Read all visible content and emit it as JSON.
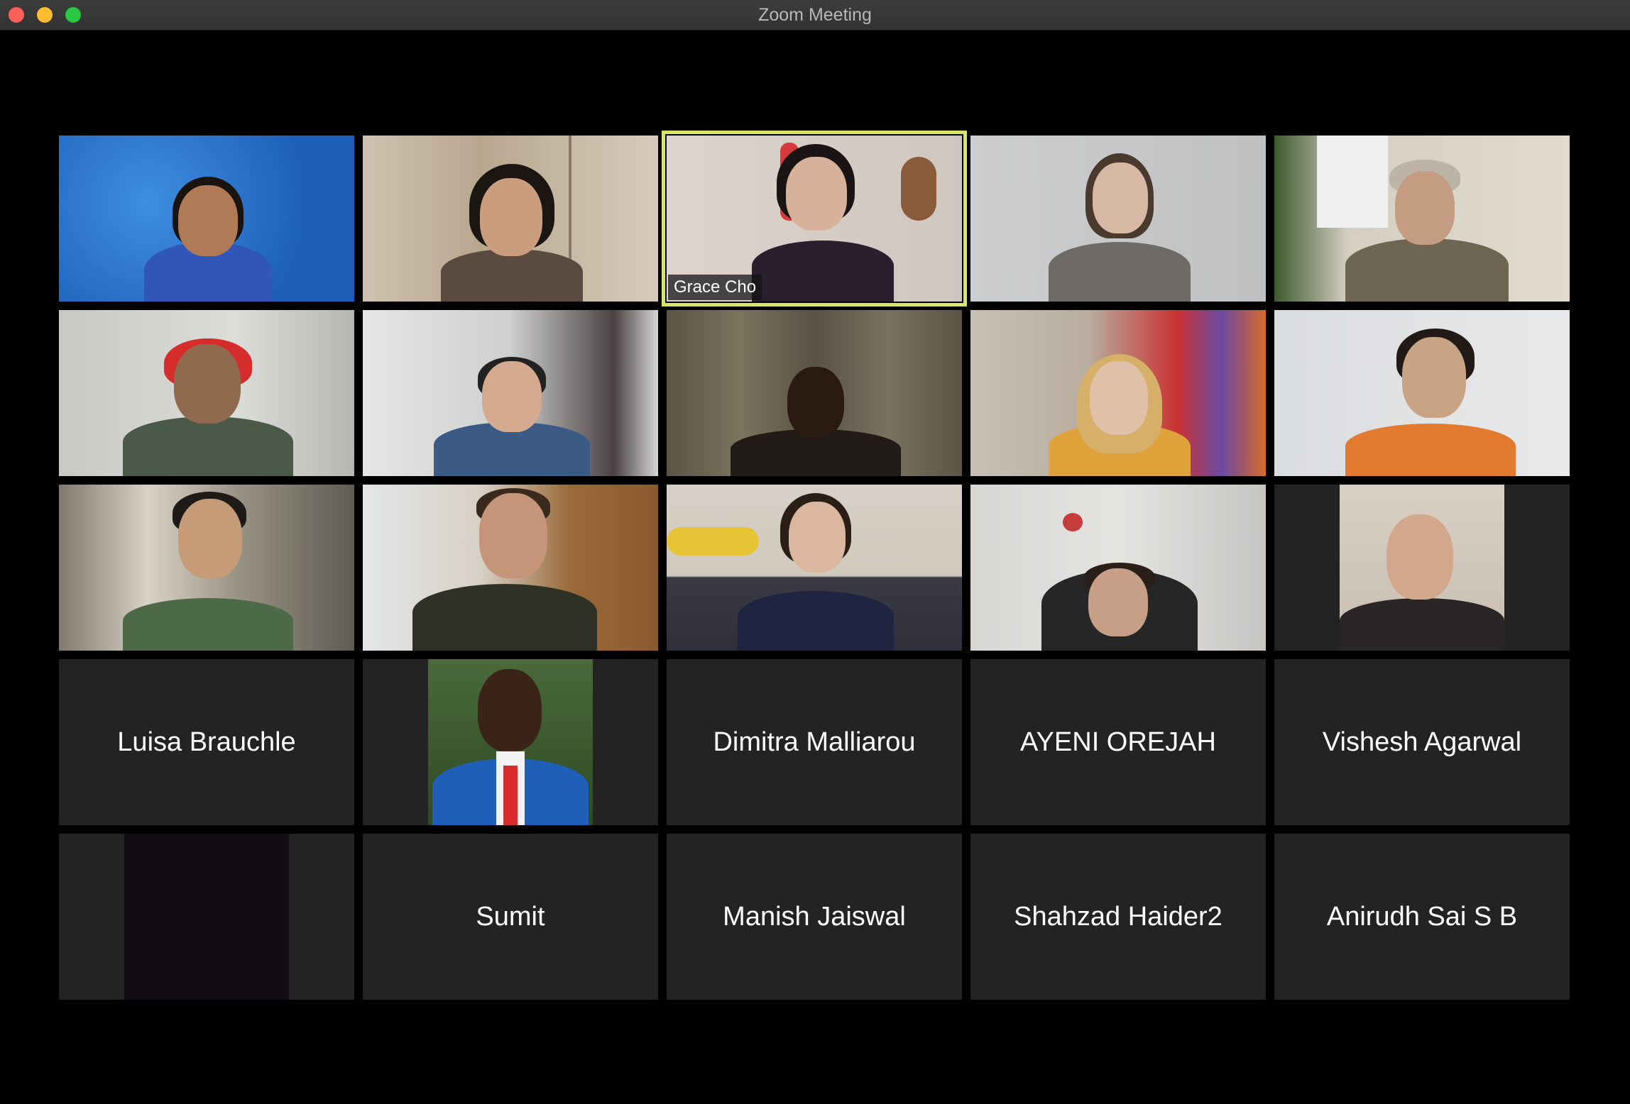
{
  "window": {
    "title": "Zoom Meeting"
  },
  "participants": [
    {
      "id": "p1",
      "label": "",
      "video": true
    },
    {
      "id": "p2",
      "label": "",
      "video": true
    },
    {
      "id": "p3",
      "label": "Grace Cho",
      "video": true,
      "active_speaker": true
    },
    {
      "id": "p4",
      "label": "",
      "video": true
    },
    {
      "id": "p5",
      "label": "",
      "video": true
    },
    {
      "id": "p6",
      "label": "",
      "video": true
    },
    {
      "id": "p7",
      "label": "",
      "video": true
    },
    {
      "id": "p8",
      "label": "",
      "video": true
    },
    {
      "id": "p9",
      "label": "",
      "video": true
    },
    {
      "id": "p10",
      "label": "",
      "video": true
    },
    {
      "id": "p11",
      "label": "",
      "video": true
    },
    {
      "id": "p12",
      "label": "",
      "video": true
    },
    {
      "id": "p13",
      "label": "",
      "video": true
    },
    {
      "id": "p14",
      "label": "",
      "video": true
    },
    {
      "id": "p15",
      "label": "",
      "video": true
    },
    {
      "id": "p16",
      "label": "Luisa Brauchle",
      "video": false
    },
    {
      "id": "p17",
      "label": "",
      "video": "profile-photo"
    },
    {
      "id": "p18",
      "label": "Dimitra Malliarou",
      "video": false
    },
    {
      "id": "p19",
      "label": "AYENI OREJAH",
      "video": false
    },
    {
      "id": "p20",
      "label": "Vishesh Agarwal",
      "video": false
    },
    {
      "id": "p21",
      "label": "",
      "video": "dark"
    },
    {
      "id": "p22",
      "label": "Sumit",
      "video": false
    },
    {
      "id": "p23",
      "label": "Manish Jaiswal",
      "video": false
    },
    {
      "id": "p24",
      "label": "Shahzad Haider2",
      "video": false
    },
    {
      "id": "p25",
      "label": "Anirudh Sai S B",
      "video": false
    }
  ],
  "colors": {
    "active_speaker_border": "#d9e56a",
    "tile_background": "#232323",
    "window_background": "#000000"
  }
}
